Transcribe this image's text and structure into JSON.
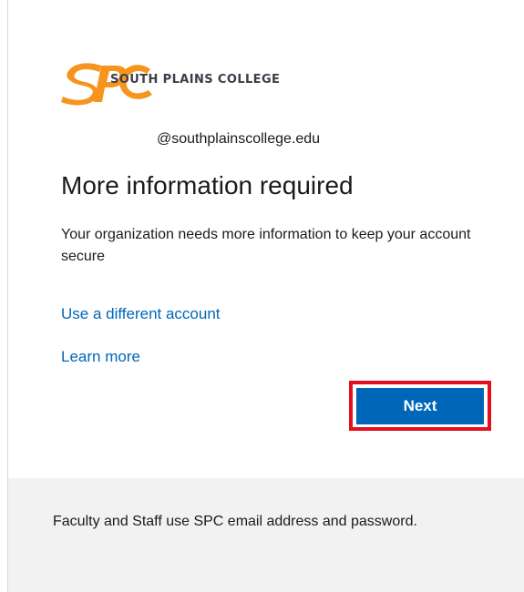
{
  "branding": {
    "logo_monogram": "SPC",
    "logo_text": "SOUTH PLAINS COLLEGE",
    "brand_color": "#f7941d"
  },
  "identity": {
    "account": "@southplainscollege.edu"
  },
  "main": {
    "title": "More information required",
    "description": "Your organization needs more information to keep your account secure",
    "use_different_account_label": "Use a different account",
    "learn_more_label": "Learn more",
    "next_label": "Next"
  },
  "footer": {
    "text": "Faculty and Staff use SPC email address and password."
  },
  "colors": {
    "link": "#0067b8",
    "primary_button": "#0067b8",
    "highlight": "#e3101f",
    "footer_background": "#f2f2f2"
  }
}
